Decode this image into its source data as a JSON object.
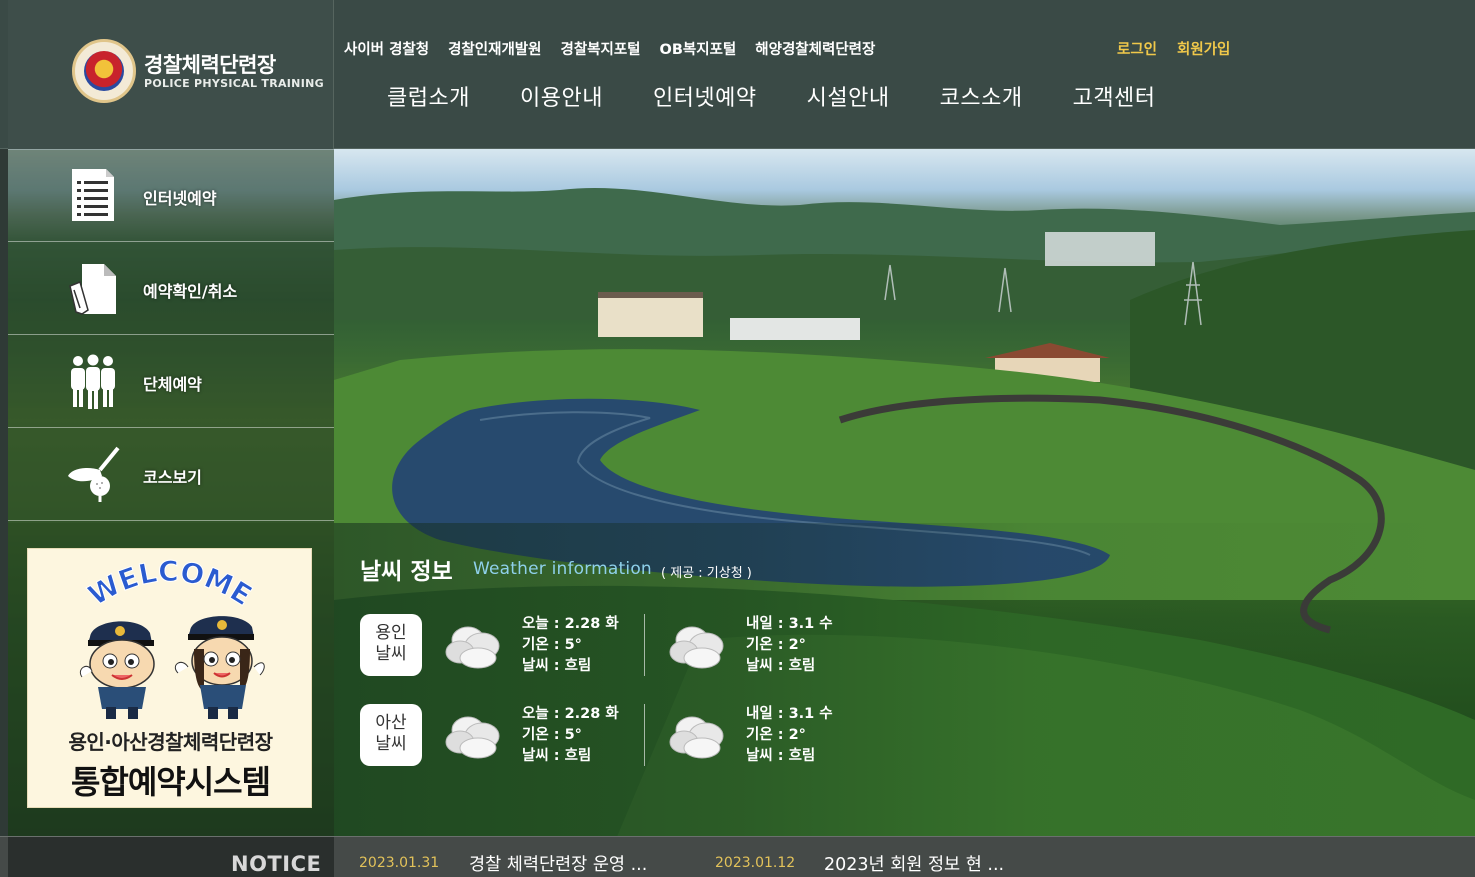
{
  "brand": {
    "title": "경찰체력단련장",
    "subtitle": "POLICE PHYSICAL TRAINING"
  },
  "top_links": [
    "사이버 경찰청",
    "경찰인재개발원",
    "경찰복지포털",
    "OB복지포털",
    "해양경찰체력단련장"
  ],
  "auth": {
    "login": "로그인",
    "signup": "회원가입"
  },
  "main_nav": [
    "클럽소개",
    "이용안내",
    "인터넷예약",
    "시설안내",
    "코스소개",
    "고객센터"
  ],
  "quick_menu": [
    {
      "label": "인터넷예약",
      "icon": "document-icon"
    },
    {
      "label": "예약확인/취소",
      "icon": "edit-document-icon"
    },
    {
      "label": "단체예약",
      "icon": "group-icon"
    },
    {
      "label": "코스보기",
      "icon": "golf-club-icon"
    }
  ],
  "welcome": {
    "arc": "WELCOME",
    "line1": "용인·아산경찰체력단련장",
    "line2": "통합예약시스템"
  },
  "weather": {
    "title": "날씨 정보",
    "subtitle": "Weather information",
    "source": "( 제공 : 기상청 )",
    "rows": [
      {
        "city": [
          "용인",
          "날씨"
        ],
        "today": {
          "date": "오늘 : 2.28 화",
          "temp": "기온 : 5°",
          "cond": "날씨 : 흐림"
        },
        "tomorrow": {
          "date": "내일 : 3.1 수",
          "temp": "기온 : 2°",
          "cond": "날씨 : 흐림"
        }
      },
      {
        "city": [
          "아산",
          "날씨"
        ],
        "today": {
          "date": "오늘 : 2.28 화",
          "temp": "기온 : 5°",
          "cond": "날씨 : 흐림"
        },
        "tomorrow": {
          "date": "내일 : 3.1 수",
          "temp": "기온 : 2°",
          "cond": "날씨 : 흐림"
        }
      }
    ]
  },
  "notice": {
    "label": "NOTICE",
    "items": [
      {
        "date": "2023.01.31",
        "title": "경찰 체력단련장 운영 ..."
      },
      {
        "date": "2023.01.12",
        "title": "2023년 회원 정보 현 ..."
      }
    ]
  },
  "colors": {
    "header_bg": "#3a4a46",
    "auth_link": "#f0c84a",
    "weather_subtitle": "#8fd0ea",
    "notice_date": "#e2c25a"
  }
}
